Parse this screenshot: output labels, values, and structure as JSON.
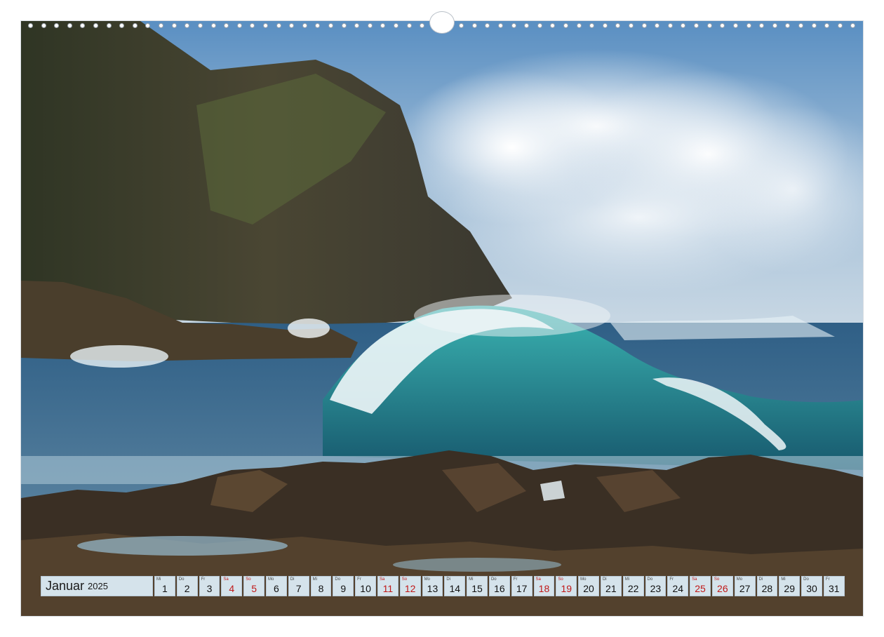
{
  "image": {
    "description_icon": "landscape-photo",
    "colors": {
      "sky": "#6f9ec9",
      "sea": "#2f6f8f",
      "wave": "#2aa7a8",
      "cliff": "#3d3a2b",
      "rock": "#3a2f24"
    }
  },
  "calendar": {
    "month": "Januar",
    "year": "2025",
    "weekend_color": "#c01818",
    "days": [
      {
        "dow": "Mi",
        "num": "1",
        "weekend": false
      },
      {
        "dow": "Do",
        "num": "2",
        "weekend": false
      },
      {
        "dow": "Fr",
        "num": "3",
        "weekend": false
      },
      {
        "dow": "Sa",
        "num": "4",
        "weekend": true
      },
      {
        "dow": "So",
        "num": "5",
        "weekend": true
      },
      {
        "dow": "Mo",
        "num": "6",
        "weekend": false
      },
      {
        "dow": "Di",
        "num": "7",
        "weekend": false
      },
      {
        "dow": "Mi",
        "num": "8",
        "weekend": false
      },
      {
        "dow": "Do",
        "num": "9",
        "weekend": false
      },
      {
        "dow": "Fr",
        "num": "10",
        "weekend": false
      },
      {
        "dow": "Sa",
        "num": "11",
        "weekend": true
      },
      {
        "dow": "So",
        "num": "12",
        "weekend": true
      },
      {
        "dow": "Mo",
        "num": "13",
        "weekend": false
      },
      {
        "dow": "Di",
        "num": "14",
        "weekend": false
      },
      {
        "dow": "Mi",
        "num": "15",
        "weekend": false
      },
      {
        "dow": "Do",
        "num": "16",
        "weekend": false
      },
      {
        "dow": "Fr",
        "num": "17",
        "weekend": false
      },
      {
        "dow": "Sa",
        "num": "18",
        "weekend": true
      },
      {
        "dow": "So",
        "num": "19",
        "weekend": true
      },
      {
        "dow": "Mo",
        "num": "20",
        "weekend": false
      },
      {
        "dow": "Di",
        "num": "21",
        "weekend": false
      },
      {
        "dow": "Mi",
        "num": "22",
        "weekend": false
      },
      {
        "dow": "Do",
        "num": "23",
        "weekend": false
      },
      {
        "dow": "Fr",
        "num": "24",
        "weekend": false
      },
      {
        "dow": "Sa",
        "num": "25",
        "weekend": true
      },
      {
        "dow": "So",
        "num": "26",
        "weekend": true
      },
      {
        "dow": "Mo",
        "num": "27",
        "weekend": false
      },
      {
        "dow": "Di",
        "num": "28",
        "weekend": false
      },
      {
        "dow": "Mi",
        "num": "29",
        "weekend": false
      },
      {
        "dow": "Do",
        "num": "30",
        "weekend": false
      },
      {
        "dow": "Fr",
        "num": "31",
        "weekend": false
      }
    ]
  }
}
